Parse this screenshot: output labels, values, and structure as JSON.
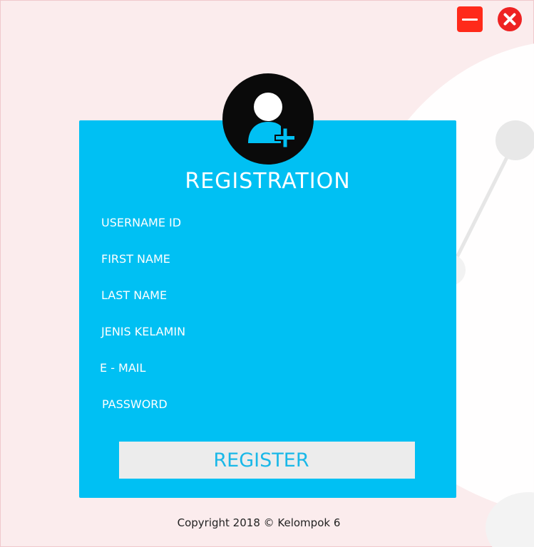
{
  "window": {
    "minimize_icon": "minus-icon",
    "close_icon": "x-circle-icon"
  },
  "colors": {
    "card": "#00c0f3",
    "background": "#fbeced",
    "minimize": "#ff2a1a",
    "close": "#ee2222",
    "button_bg": "#ececec",
    "button_text": "#1ab8e8"
  },
  "form": {
    "avatar_icon": "add-user-icon",
    "title": "REGISTRATION",
    "fields": {
      "username": "USERNAME ID",
      "first_name": "FIRST NAME",
      "last_name": "LAST NAME",
      "gender": "JENIS KELAMIN",
      "email": "E - MAIL",
      "password": "PASSWORD"
    },
    "register_label": "REGISTER"
  },
  "footer": {
    "copyright": "Copyright 2018 © Kelompok 6"
  }
}
